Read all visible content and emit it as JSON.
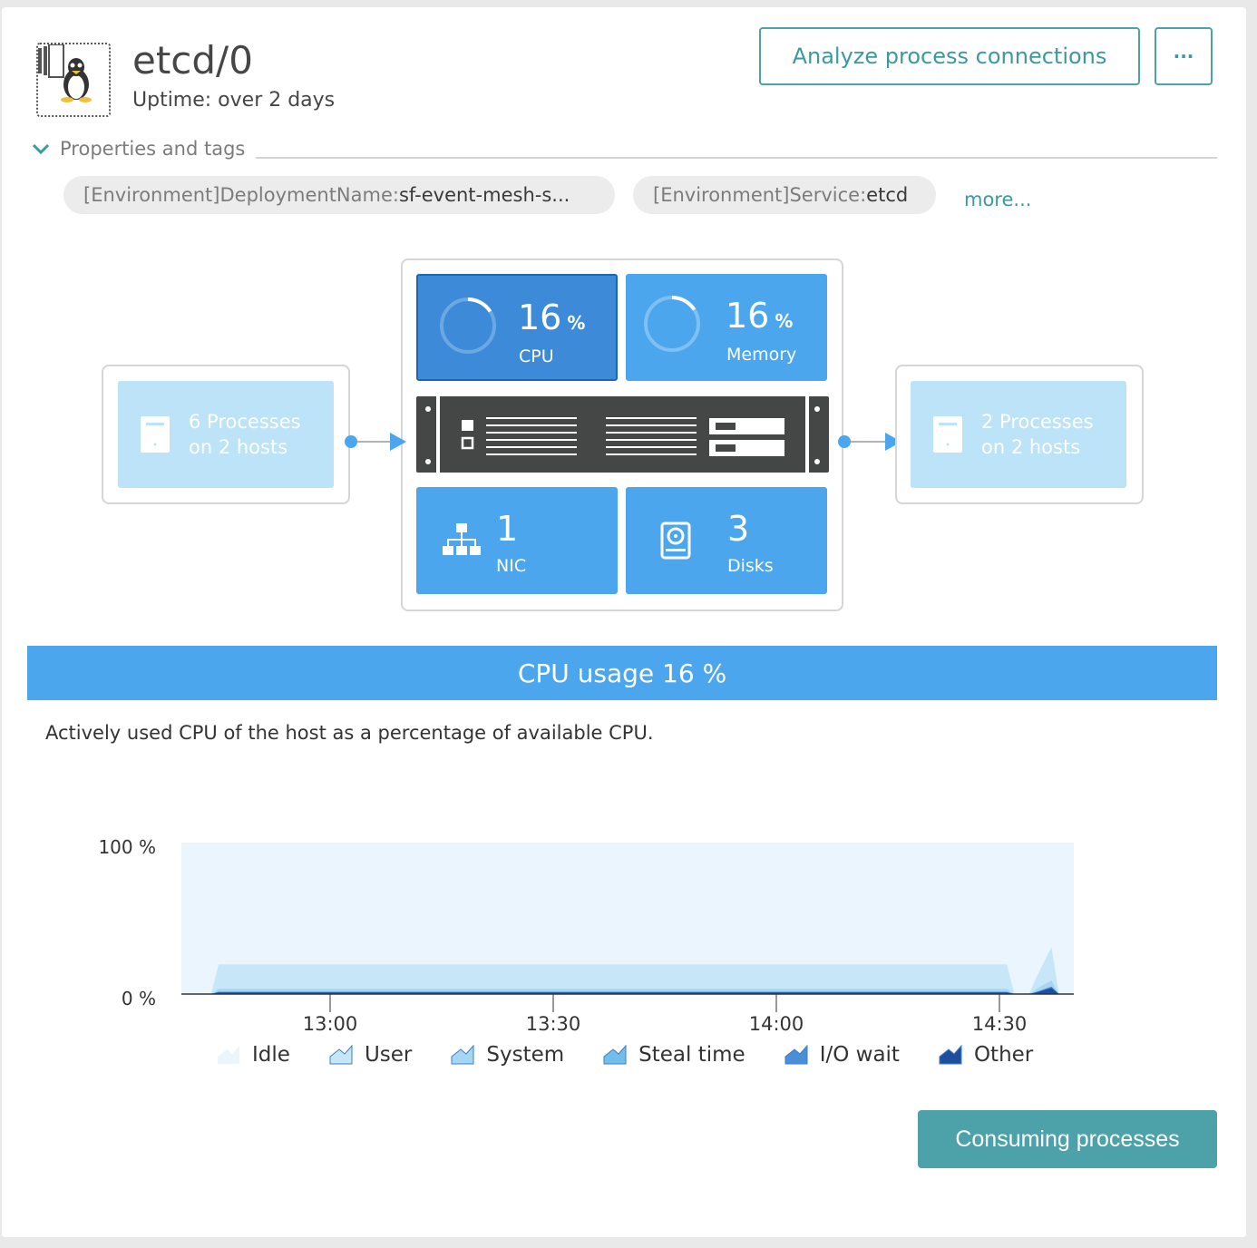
{
  "header": {
    "title": "etcd/0",
    "uptime": "Uptime: over 2 days",
    "analyze_label": "Analyze process connections",
    "more_menu_label": "···"
  },
  "properties": {
    "toggle_label": "Properties and tags",
    "tags": [
      {
        "key": "[Environment]DeploymentName:",
        "value": " sf-event-mesh-s..."
      },
      {
        "key": "[Environment]Service:",
        "value": " etcd"
      }
    ],
    "more_label": "more..."
  },
  "topology": {
    "left_group": {
      "line1": "6 Processes",
      "line2": "on 2 hosts"
    },
    "right_group": {
      "line1": "2 Processes",
      "line2": "on 2 hosts"
    },
    "cpu": {
      "value": "16",
      "unit": "%",
      "label": "CPU",
      "fraction": 0.16
    },
    "memory": {
      "value": "16",
      "unit": "%",
      "label": "Memory",
      "fraction": 0.16
    },
    "nic": {
      "value": "1",
      "label": "NIC"
    },
    "disks": {
      "value": "3",
      "label": "Disks"
    }
  },
  "cpu_section": {
    "title": "CPU usage 16 %",
    "description": "Actively used CPU of the host as a percentage of available CPU."
  },
  "chart_data": {
    "type": "area",
    "title": "",
    "xlabel": "",
    "ylabel": "",
    "ylim": [
      0,
      100
    ],
    "y_ticks": [
      "100 %",
      "0 %"
    ],
    "x_ticks": [
      "13:00",
      "13:30",
      "14:00",
      "14:30"
    ],
    "x_tick_minutes": [
      780,
      810,
      840,
      870
    ],
    "x_range_minutes": [
      760,
      880
    ],
    "stacked": true,
    "x": [
      760,
      764,
      765,
      767,
      800,
      840,
      870,
      871,
      872,
      874,
      875,
      877,
      878,
      880
    ],
    "series": [
      {
        "name": "Idle",
        "color": "#eaf5fd",
        "values": [
          100,
          100,
          100,
          100,
          100,
          100,
          100,
          100,
          100,
          100,
          100,
          100,
          100,
          100
        ]
      },
      {
        "name": "User",
        "color": "#c7e6f8",
        "values": [
          0,
          0,
          16,
          16,
          16,
          16,
          16,
          16,
          0,
          0,
          8,
          22,
          0,
          0
        ]
      },
      {
        "name": "System",
        "color": "#a6d6f3",
        "values": [
          0,
          0,
          2,
          2,
          2,
          2,
          2,
          2,
          0,
          0,
          2,
          4,
          0,
          0
        ]
      },
      {
        "name": "Steal time",
        "color": "#72bdec",
        "values": [
          0,
          0,
          0,
          0,
          0,
          0,
          0,
          0,
          0,
          0,
          0,
          0,
          0,
          0
        ]
      },
      {
        "name": "I/O wait",
        "color": "#4a8fd6",
        "values": [
          0,
          0,
          0.5,
          0.5,
          0.5,
          0.5,
          0.5,
          0.5,
          0,
          0,
          0.5,
          1,
          0,
          0
        ]
      },
      {
        "name": "Other",
        "color": "#1f4e9a",
        "values": [
          0,
          0,
          1,
          1,
          1,
          1,
          1,
          1,
          0,
          0,
          1,
          4,
          0,
          0
        ]
      }
    ],
    "legend_position": "bottom",
    "grid": false
  },
  "actions": {
    "consuming_label": "Consuming processes"
  }
}
